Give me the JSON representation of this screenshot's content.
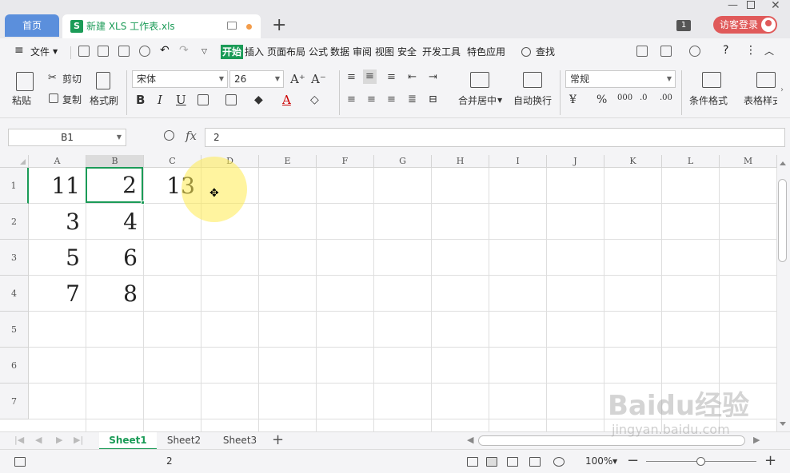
{
  "titlebar": {
    "home_tab": "首页",
    "doc_tab": "新建 XLS 工作表.xls",
    "doc_icon": "S",
    "window_count": "1",
    "login_label": "访客登录"
  },
  "menubar": {
    "file": "文件",
    "tabs": [
      "开始",
      "插入",
      "页面布局",
      "公式",
      "数据",
      "审阅",
      "视图",
      "安全",
      "开发工具",
      "特色应用"
    ],
    "active_tab": "开始",
    "search": "查找"
  },
  "ribbon": {
    "paste": "粘贴",
    "cut": "剪切",
    "copy": "复制",
    "format_painter": "格式刷",
    "font_name": "宋体",
    "font_size": "26",
    "merge_center": "合并居中",
    "wrap_text": "自动换行",
    "number_format": "常规",
    "cond_format": "条件格式",
    "table_style": "表格样式"
  },
  "formula_bar": {
    "name_box": "B1",
    "fx": "fx",
    "value": "2"
  },
  "grid": {
    "columns": [
      "A",
      "B",
      "C",
      "D",
      "E",
      "F",
      "G",
      "H",
      "I",
      "J",
      "K",
      "L",
      "M"
    ],
    "rows": [
      "1",
      "2",
      "3",
      "4",
      "5",
      "6",
      "7"
    ],
    "cells": [
      [
        "11",
        "2",
        "13"
      ],
      [
        "3",
        "4"
      ],
      [
        "5",
        "6"
      ],
      [
        "7",
        "8"
      ]
    ],
    "active_cell": "B1"
  },
  "sheets": {
    "tabs": [
      "Sheet1",
      "Sheet2",
      "Sheet3"
    ],
    "active": "Sheet1"
  },
  "status": {
    "value": "2",
    "zoom": "100%"
  },
  "watermark": {
    "text": "Baidu经验",
    "url_text": "jingyan.baidu.com"
  },
  "colors": {
    "accent": "#1b9b57",
    "home_tab": "#5b8fdc",
    "login": "#e05a5a",
    "highlight": "#ffeb50"
  }
}
